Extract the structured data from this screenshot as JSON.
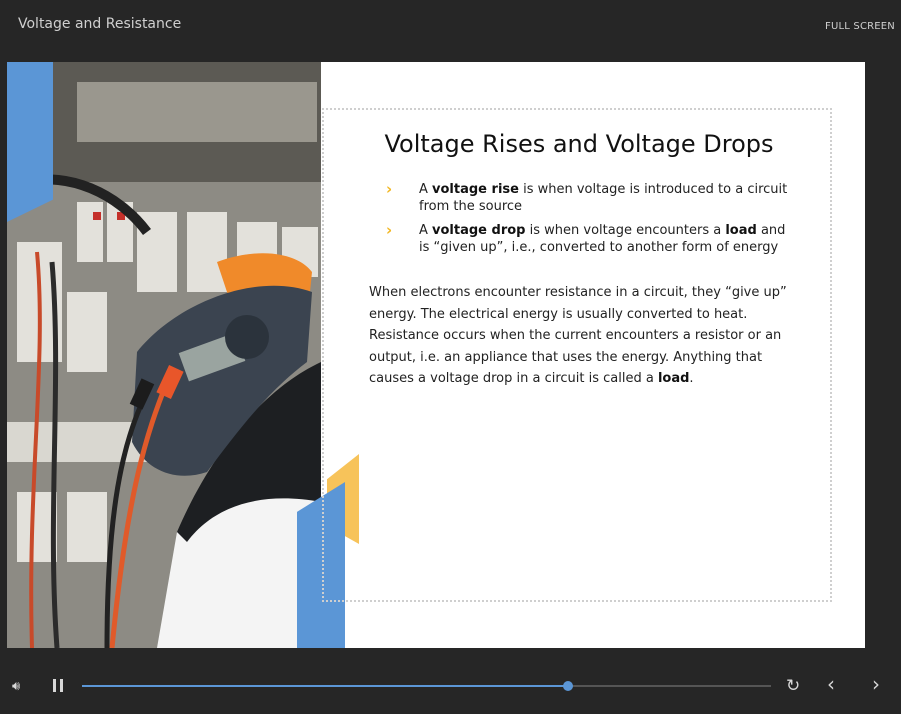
{
  "header": {
    "course_title": "Voltage and Resistance",
    "fullscreen_label": "FULL SCREEN"
  },
  "slide": {
    "title": "Voltage Rises and Voltage Drops",
    "bullets": [
      {
        "parts": [
          "A ",
          "voltage rise",
          " is when voltage is introduced to a circuit from the source"
        ]
      },
      {
        "parts": [
          "A ",
          "voltage drop",
          " is when voltage encounters a ",
          "load",
          " and is “given up”, i.e., converted to another form of energy"
        ]
      }
    ],
    "paragraph": {
      "text": "When electrons encounter resistance in a circuit, they “give up” energy. The electrical energy is usually converted to heat. Resistance occurs when the current encounters a resistor or an output, i.e. an appliance that uses the energy. Anything that causes a voltage drop in a circuit is called a ",
      "bold_end": "load",
      "end": "."
    },
    "bullet_icon": "chevron-right-icon",
    "colors": {
      "accent_yellow": "#f7c35a",
      "accent_blue": "#5b96d6",
      "bullet": "#f2b722"
    }
  },
  "controls": {
    "progress": 0.705,
    "icons": [
      "volume-icon",
      "pause-icon",
      "replay-icon",
      "prev-icon",
      "next-icon"
    ]
  }
}
